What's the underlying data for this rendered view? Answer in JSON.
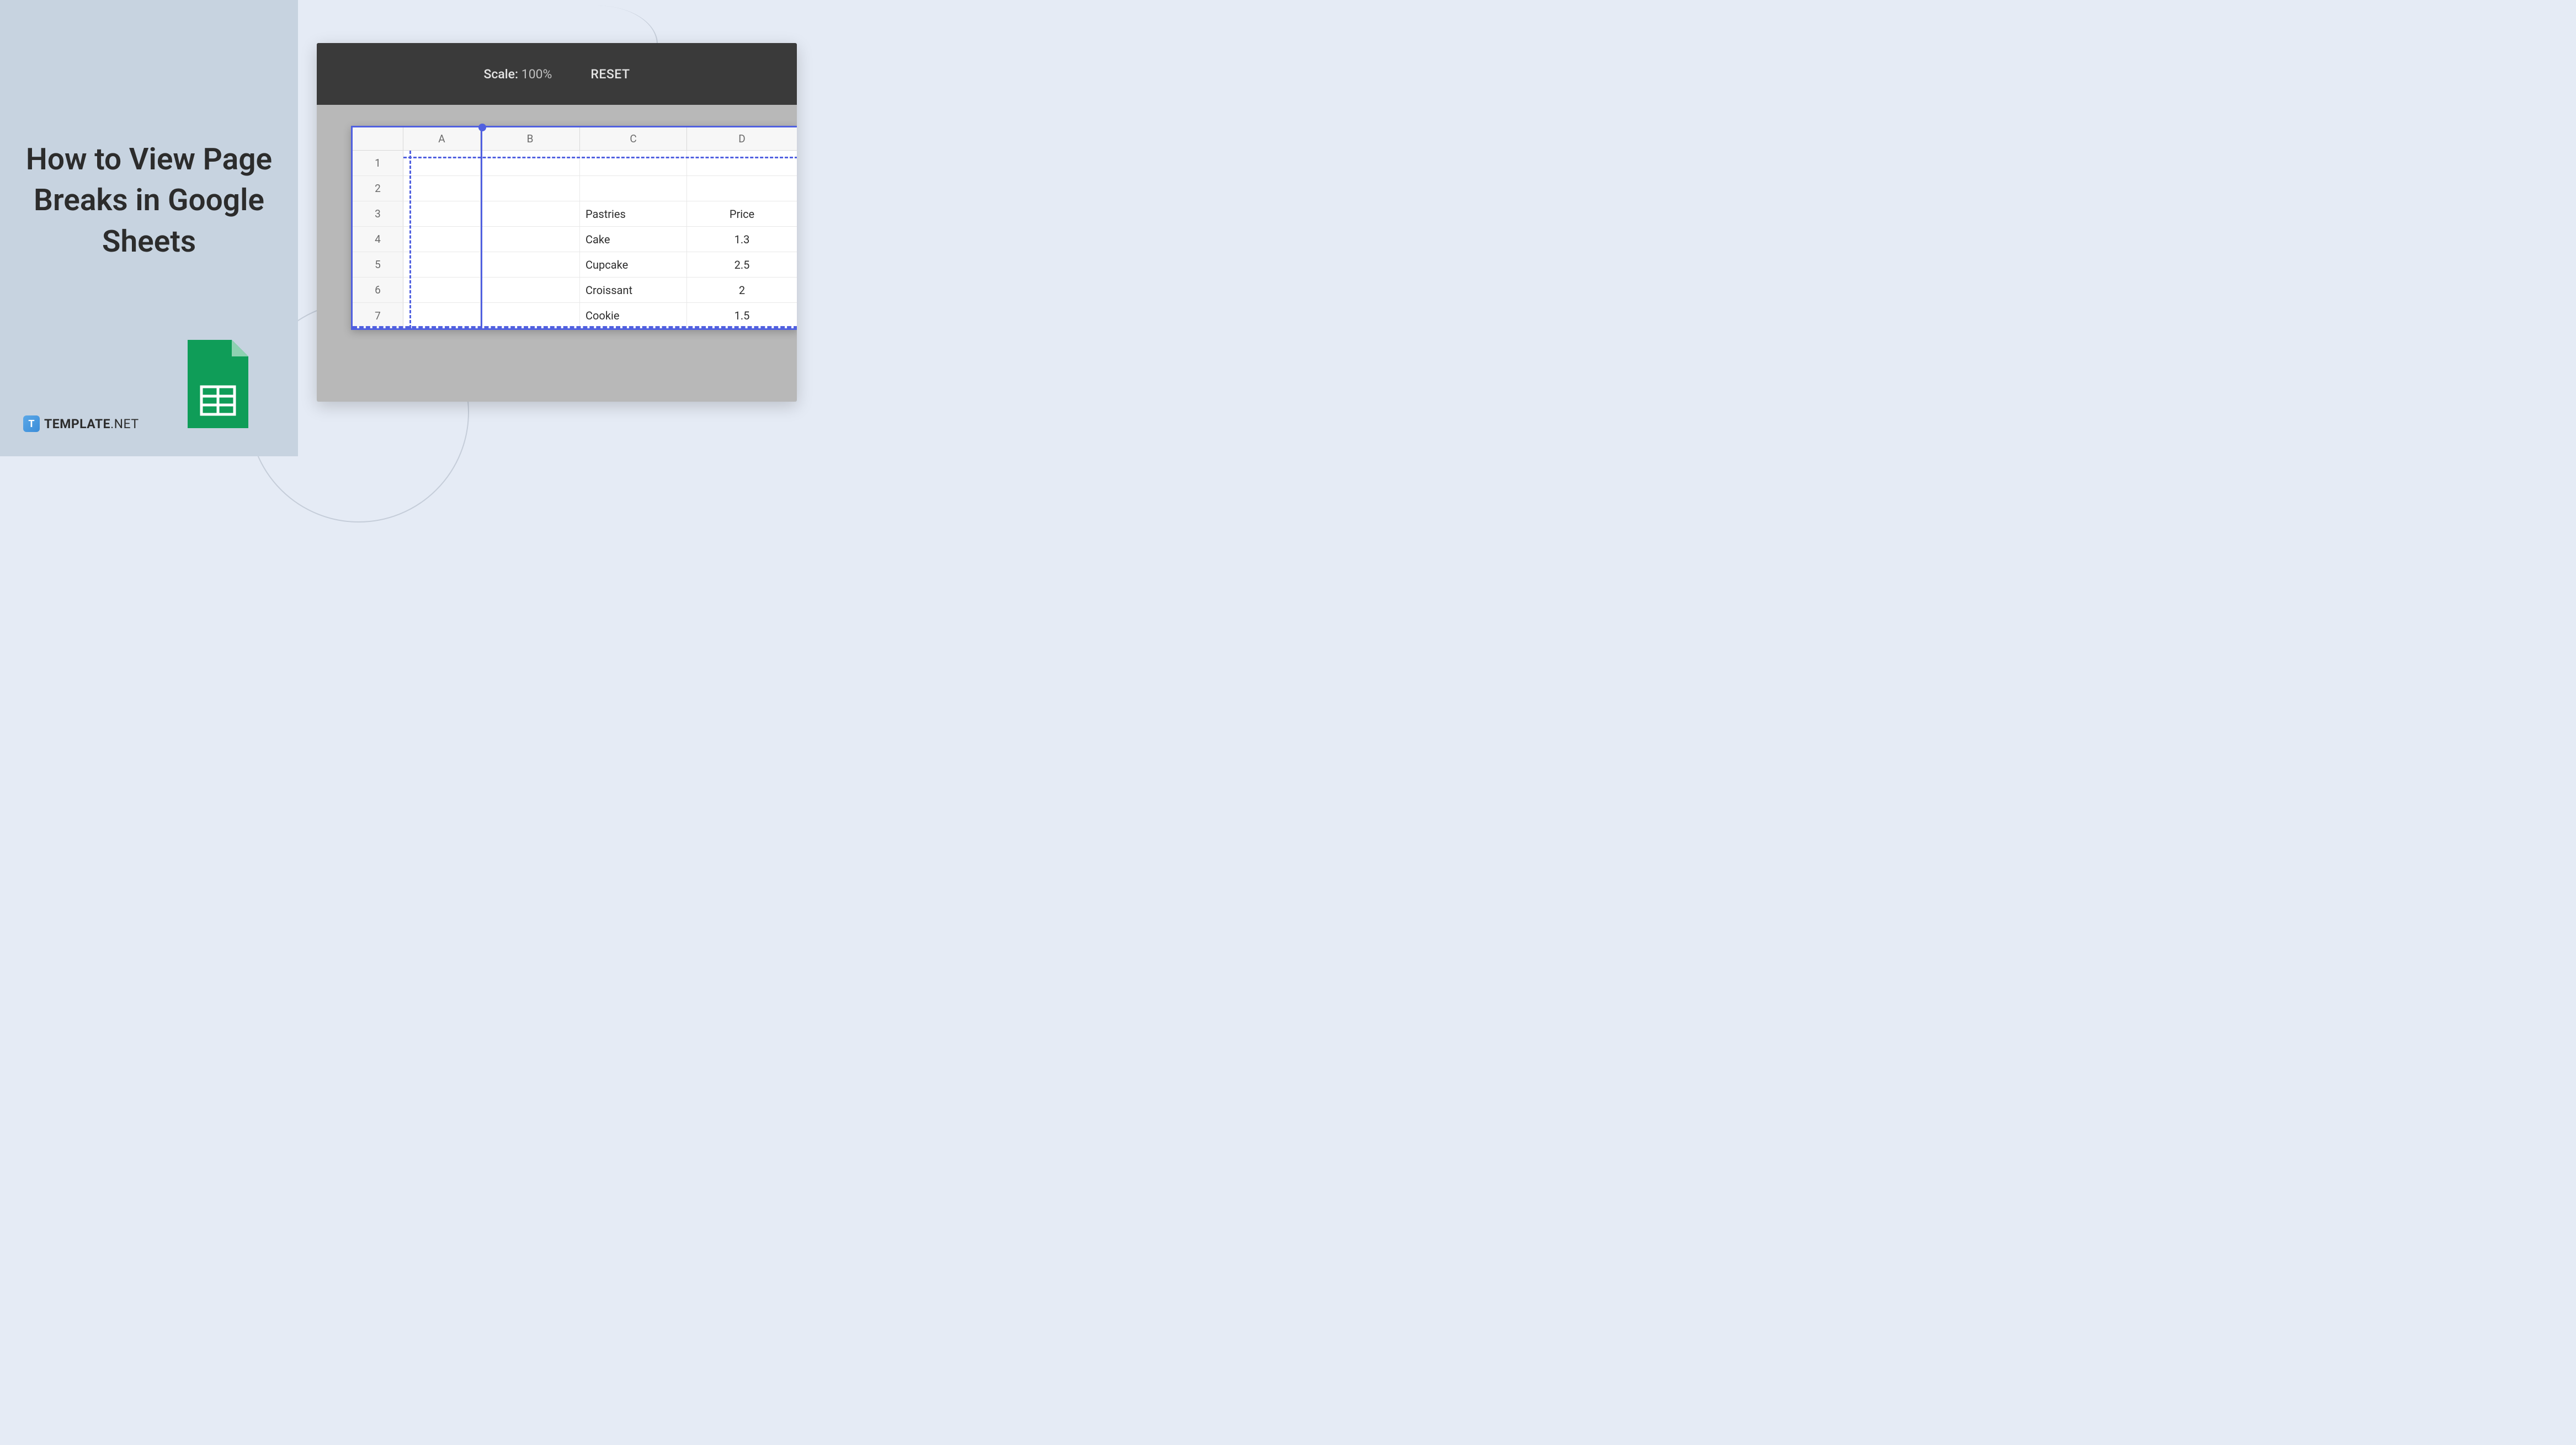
{
  "title": "How to View Page Breaks in Google Sheets",
  "brand": {
    "icon_letter": "T",
    "name": "TEMPLATE",
    "suffix": ".NET"
  },
  "toolbar": {
    "scale_label": "Scale:",
    "scale_value": "100%",
    "reset_label": "RESET"
  },
  "columns": [
    "A",
    "B",
    "C",
    "D"
  ],
  "rows": [
    "1",
    "2",
    "3",
    "4",
    "5",
    "6",
    "7"
  ],
  "data": {
    "C3": "Pastries",
    "D3": "Price",
    "C4": "Cake",
    "D4": "1.3",
    "C5": "Cupcake",
    "D5": "2.5",
    "C6": "Croissant",
    "D6": "2",
    "C7": "Cookie",
    "D7": "1.5"
  },
  "colors": {
    "page_break": "#5060e0",
    "panel_bg": "#c7d3e0",
    "body_bg": "#e5ebf5",
    "toolbar_bg": "#3a3a3a",
    "sheets_green": "#0f9d58"
  }
}
